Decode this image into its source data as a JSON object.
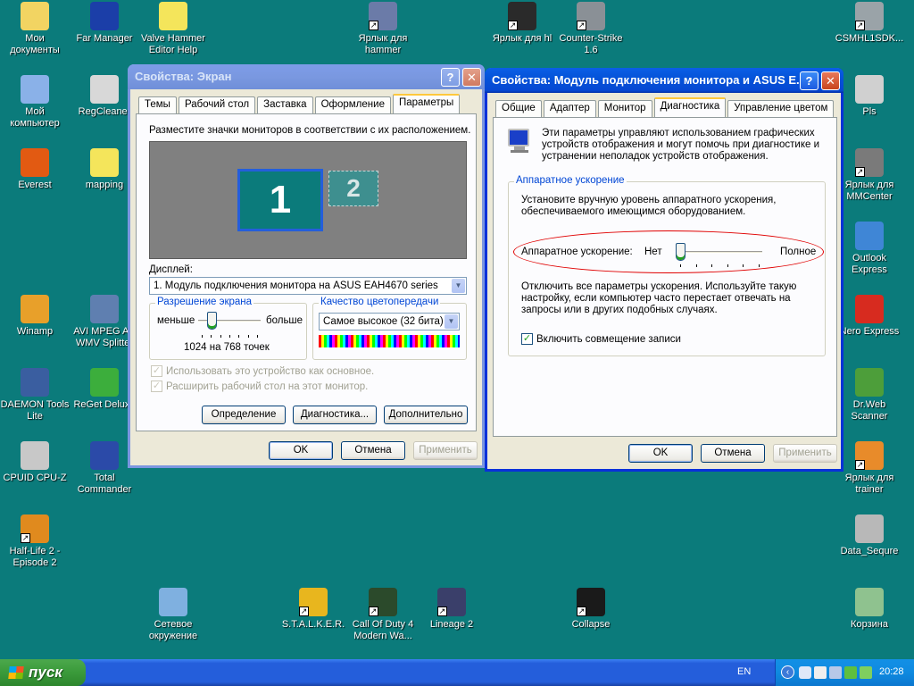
{
  "desktop": {
    "icons": [
      {
        "label": "Мои документы",
        "icon": "my-documents-icon",
        "color": "#f2d462"
      },
      {
        "label": "Far Manager",
        "icon": "far-manager-icon",
        "color": "#1b3ea8"
      },
      {
        "label": "Valve Hammer Editor Help",
        "icon": "help-icon",
        "color": "#f4e55b"
      },
      {
        "label": "Ярлык для hammer",
        "icon": "hammer-icon",
        "color": "#6b7ba8"
      },
      {
        "label": "Ярлык для hl",
        "icon": "half-life-icon",
        "color": "#2a2a2a"
      },
      {
        "label": "Counter-Strike 1.6",
        "icon": "counter-strike-icon",
        "color": "#8a9096"
      },
      {
        "label": "CSMHL1SDK...",
        "icon": "csm-icon",
        "color": "#9aa3a8"
      },
      {
        "label": "Мой компьютер",
        "icon": "my-computer-icon",
        "color": "#8ab1e8"
      },
      {
        "label": "RegCleaner",
        "icon": "regcleaner-icon",
        "color": "#d8d8d8"
      },
      {
        "label": "Pls",
        "icon": "cdrom-icon",
        "color": "#d0d0d0"
      },
      {
        "label": "Everest",
        "icon": "everest-icon",
        "color": "#e25a12"
      },
      {
        "label": "mapping",
        "icon": "help-icon",
        "color": "#f4e55b"
      },
      {
        "label": "Ярлык для MMCenter",
        "icon": "mmcenter-icon",
        "color": "#7a7a7a"
      },
      {
        "label": "Outlook Express",
        "icon": "outlook-express-icon",
        "color": "#3f86d6"
      },
      {
        "label": "Winamp",
        "icon": "winamp-icon",
        "color": "#e8a02a"
      },
      {
        "label": "AVI MPEG AS WMV Splitter",
        "icon": "splitter-icon",
        "color": "#5f7fb0"
      },
      {
        "label": "Nero Express",
        "icon": "nero-icon",
        "color": "#d72b1f"
      },
      {
        "label": "DAEMON Tools Lite",
        "icon": "daemon-tools-icon",
        "color": "#3a5ea0"
      },
      {
        "label": "ReGet Deluxe",
        "icon": "reget-icon",
        "color": "#3cae3c"
      },
      {
        "label": "Dr.Web Scanner",
        "icon": "drweb-icon",
        "color": "#4d9e3a"
      },
      {
        "label": "CPUID CPU-Z",
        "icon": "cpuz-icon",
        "color": "#c8c8c8"
      },
      {
        "label": "Total Commander",
        "icon": "total-commander-icon",
        "color": "#2b4aa8"
      },
      {
        "label": "Ярлык для trainer",
        "icon": "trainer-icon",
        "color": "#e88b2a"
      },
      {
        "label": "Half-Life 2 - Episode 2",
        "icon": "hl2-icon",
        "color": "#e08a1e"
      },
      {
        "label": "Data_Sequre",
        "icon": "drive-icon",
        "color": "#b8b8b8"
      },
      {
        "label": "Сетевое окружение",
        "icon": "network-icon",
        "color": "#7fb0e0"
      },
      {
        "label": "S.T.A.L.K.E.R.",
        "icon": "stalker-icon",
        "color": "#e8b61e"
      },
      {
        "label": "Call Of Duty 4 Modern Wa...",
        "icon": "cod4-icon",
        "color": "#2b4a2b"
      },
      {
        "label": "Lineage 2",
        "icon": "lineage-icon",
        "color": "#3a3f6a"
      },
      {
        "label": "Collapse",
        "icon": "collapse-icon",
        "color": "#1a1a1a"
      },
      {
        "label": "Корзина",
        "icon": "recycle-bin-icon",
        "color": "#8fc28f"
      }
    ]
  },
  "display_window": {
    "title": "Свойства: Экран",
    "tabs": [
      "Темы",
      "Рабочий стол",
      "Заставка",
      "Оформление",
      "Параметры"
    ],
    "instruction": "Разместите значки мониторов в соответствии с их расположением.",
    "monitor1": "1",
    "monitor2": "2",
    "display_label": "Дисплей:",
    "display_value": "1. Модуль подключения монитора на ASUS EAH4670 series",
    "resolution_group": "Разрешение экрана",
    "less": "меньше",
    "more": "больше",
    "resolution_value": "1024 на 768 точек",
    "resolution_level": 0.1,
    "color_group": "Качество цветопередачи",
    "color_value": "Самое высокое (32 бита)",
    "primary_check": "Использовать это устройство как основное.",
    "extend_check": "Расширить рабочий стол на этот монитор.",
    "identify_btn": "Определение",
    "troubleshoot_btn": "Диагностика...",
    "advanced_btn": "Дополнительно",
    "ok_btn": "OK",
    "cancel_btn": "Отмена",
    "apply_btn": "Применить"
  },
  "monitor_window": {
    "title": "Свойства: Модуль подключения монитора и ASUS E...",
    "tabs": [
      "Общие",
      "Адаптер",
      "Монитор",
      "Диагностика",
      "Управление цветом"
    ],
    "description": "Эти параметры управляют использованием графических устройств отображения и могут помочь при диагностике и устранении неполадок устройств отображения.",
    "accel_group": "Аппаратное ускорение",
    "accel_desc": "Установите вручную уровень аппаратного ускорения, обеспечиваемого имеющимся оборудованием.",
    "accel_label": "Аппаратное ускорение:",
    "accel_none": "Нет",
    "accel_full": "Полное",
    "accel_level": 0.0,
    "accel_note": "Отключить все параметры ускорения. Используйте такую настройку, если компьютер часто перестает отвечать на запросы или в других подобных случаях.",
    "write_combining": "Включить совмещение записи",
    "ok_btn": "OK",
    "cancel_btn": "Отмена",
    "apply_btn": "Применить",
    "highlight_color": "#e00000"
  },
  "taskbar": {
    "start_label": "пуск",
    "lang": "EN",
    "clock": "20:28"
  }
}
